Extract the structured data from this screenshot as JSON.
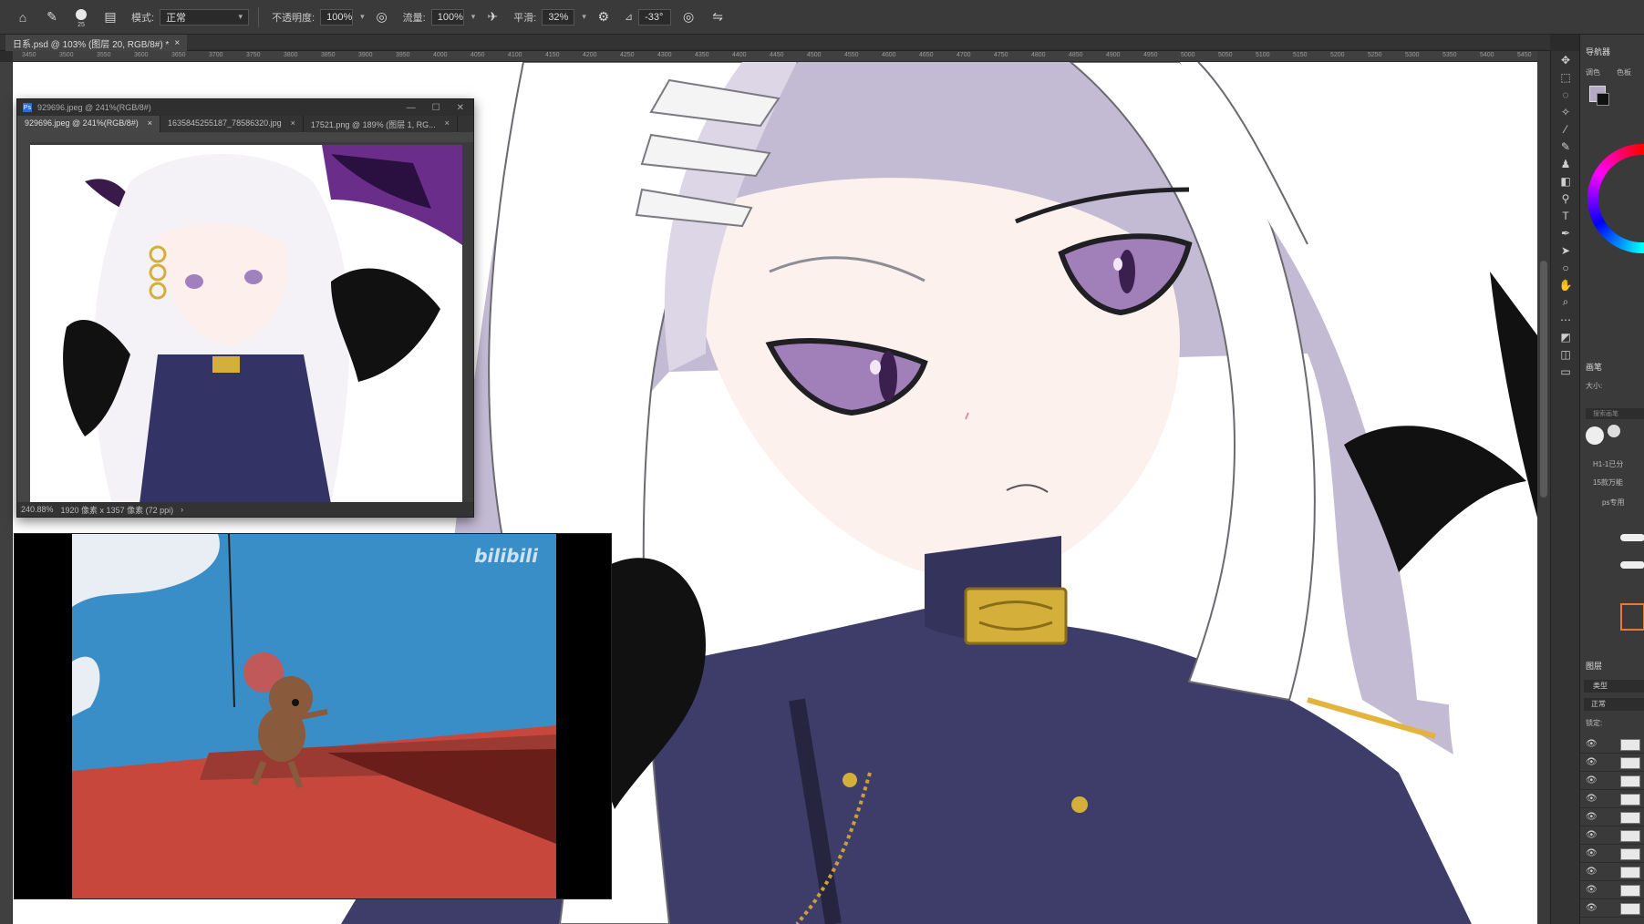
{
  "options_bar": {
    "mode_label": "模式:",
    "mode_value": "正常",
    "opacity_label": "不透明度:",
    "opacity_value": "100%",
    "flow_label": "流量:",
    "flow_value": "100%",
    "smooth_label": "平滑:",
    "smooth_value": "32%",
    "angle_value": "-33°",
    "brush_size": "25"
  },
  "document_tab": {
    "title": "日系.psd @ 103% (图层 20, RGB/8#) *",
    "close": "×"
  },
  "ruler_h_labels": [
    "3450",
    "3500",
    "3550",
    "3600",
    "3650",
    "3700",
    "3750",
    "3800",
    "3850",
    "3900",
    "3950",
    "4000",
    "4050",
    "4100",
    "4150",
    "4200",
    "4250",
    "4300",
    "4350",
    "4400",
    "4450",
    "4500",
    "4550",
    "4600",
    "4650",
    "4700",
    "4750",
    "4800",
    "4850",
    "4900",
    "4950",
    "5000",
    "5050",
    "5100",
    "5150",
    "5200",
    "5250",
    "5300",
    "5350",
    "5400",
    "5450",
    "5500"
  ],
  "reference_window": {
    "title": "929696.jpeg @ 241%(RGB/8#)",
    "tabs": [
      {
        "label": "929696.jpeg @ 241%(RGB/8#)",
        "close": "×"
      },
      {
        "label": "1635845255187_78586320.jpg",
        "close": "×"
      },
      {
        "label": "17521.png @ 189% (图层 1, RG...",
        "close": "×"
      }
    ],
    "status_zoom": "240.88%",
    "status_info": "1920 像素 x 1357 像素 (72 ppi)",
    "status_arrow": "›"
  },
  "video": {
    "watermark": "bilibili"
  },
  "panels": {
    "navigator_title": "导航器",
    "color_tab_1": "调色",
    "color_tab_2": "色板",
    "brush_title": "画笔",
    "size_label": "大小:",
    "search_placeholder": "搜索画笔",
    "brush_group_1": "H1-1已分",
    "brush_group_2": "15款万能",
    "brush_group_3": "ps专用",
    "layers_title": "图层",
    "layer_filter": "类型",
    "layer_mode": "正常",
    "lock_label": "锁定:"
  },
  "colors": {
    "hair_shadow": "#b7aecb",
    "uniform": "#3e3d6a",
    "eye": "#a17fb9",
    "gold": "#d4b03a",
    "sky": "#3a8ec7",
    "roof": "#c7473d"
  }
}
